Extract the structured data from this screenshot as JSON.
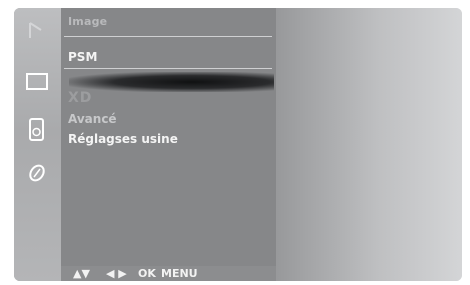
{
  "menu": {
    "title": "Image",
    "items": [
      {
        "label": "PSM"
      },
      {
        "label": "XD"
      },
      {
        "label": "Avancé"
      },
      {
        "label": "Réglagses usine"
      }
    ]
  },
  "sidebar": {
    "icons": [
      {
        "name": "picture-icon"
      },
      {
        "name": "audio-icon"
      },
      {
        "name": "option-icon"
      }
    ]
  },
  "navigation": {
    "updown": "▲▼",
    "leftright": "◀ ▶",
    "ok": "OK",
    "menu": "MENU"
  }
}
